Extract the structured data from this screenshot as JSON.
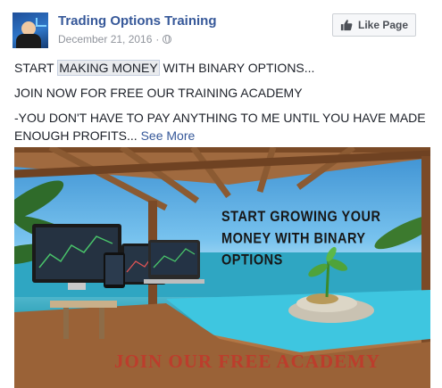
{
  "post": {
    "page_name": "Trading Options Training",
    "date": "December 21, 2016",
    "separator": "·",
    "privacy_icon": "globe-icon",
    "like_button_label": "Like Page",
    "like_button_icon": "thumbs-up-icon",
    "text": {
      "line1_before": "START ",
      "line1_highlight": "MAKING MONEY",
      "line1_after": " WITH BINARY OPTIONS...",
      "line2": "JOIN NOW FOR FREE OUR TRAINING ACADEMY",
      "line3": "-YOU DON'T HAVE TO PAY ANYTHING TO ME UNTIL YOU HAVE MADE ENOUGH PROFITS...",
      "see_more": "See More"
    },
    "image": {
      "headline_line1": "START GROWING YOUR",
      "headline_line2": "MONEY WITH BINARY",
      "headline_line3": "OPTIONS",
      "cta": "JOIN OUR FREE ACADEMY"
    }
  },
  "colors": {
    "link_blue": "#365899",
    "meta_gray": "#90949c",
    "button_bg": "#f6f7f9",
    "cta_red": "#c0392b"
  }
}
